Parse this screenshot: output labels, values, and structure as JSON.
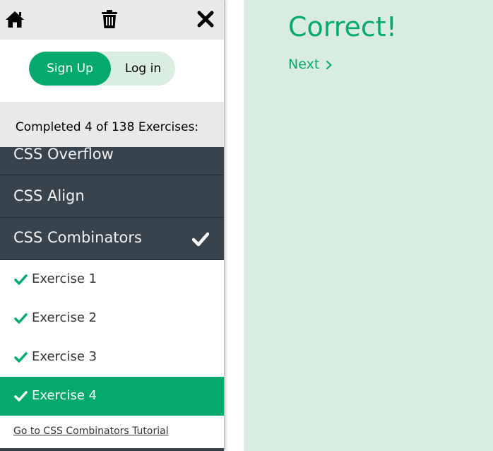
{
  "colors": {
    "accent": "#04aa6d",
    "topic_bg": "#38444d",
    "topbar_bg": "#e7e9eb",
    "main_bg": "#d9ece1",
    "pill_bg": "#d9eee1"
  },
  "topbar": {
    "icons": [
      "home-icon",
      "trash-icon",
      "close-icon"
    ]
  },
  "auth": {
    "signup_label": "Sign Up",
    "login_label": "Log in"
  },
  "progress": {
    "text": "Completed 4 of 138 Exercises:",
    "completed": 4,
    "total": 138
  },
  "topics": [
    {
      "label": "CSS Overflow"
    },
    {
      "label": "CSS Align"
    },
    {
      "label": "CSS Combinators",
      "completed": true
    }
  ],
  "exercises": [
    {
      "label": "Exercise 1",
      "completed": true
    },
    {
      "label": "Exercise 2",
      "completed": true
    },
    {
      "label": "Exercise 3",
      "completed": true
    },
    {
      "label": "Exercise 4",
      "completed": true,
      "active": true
    }
  ],
  "tutorial_link": "Go to CSS Combinators Tutorial",
  "main": {
    "result": "Correct!",
    "next_label": "Next"
  }
}
